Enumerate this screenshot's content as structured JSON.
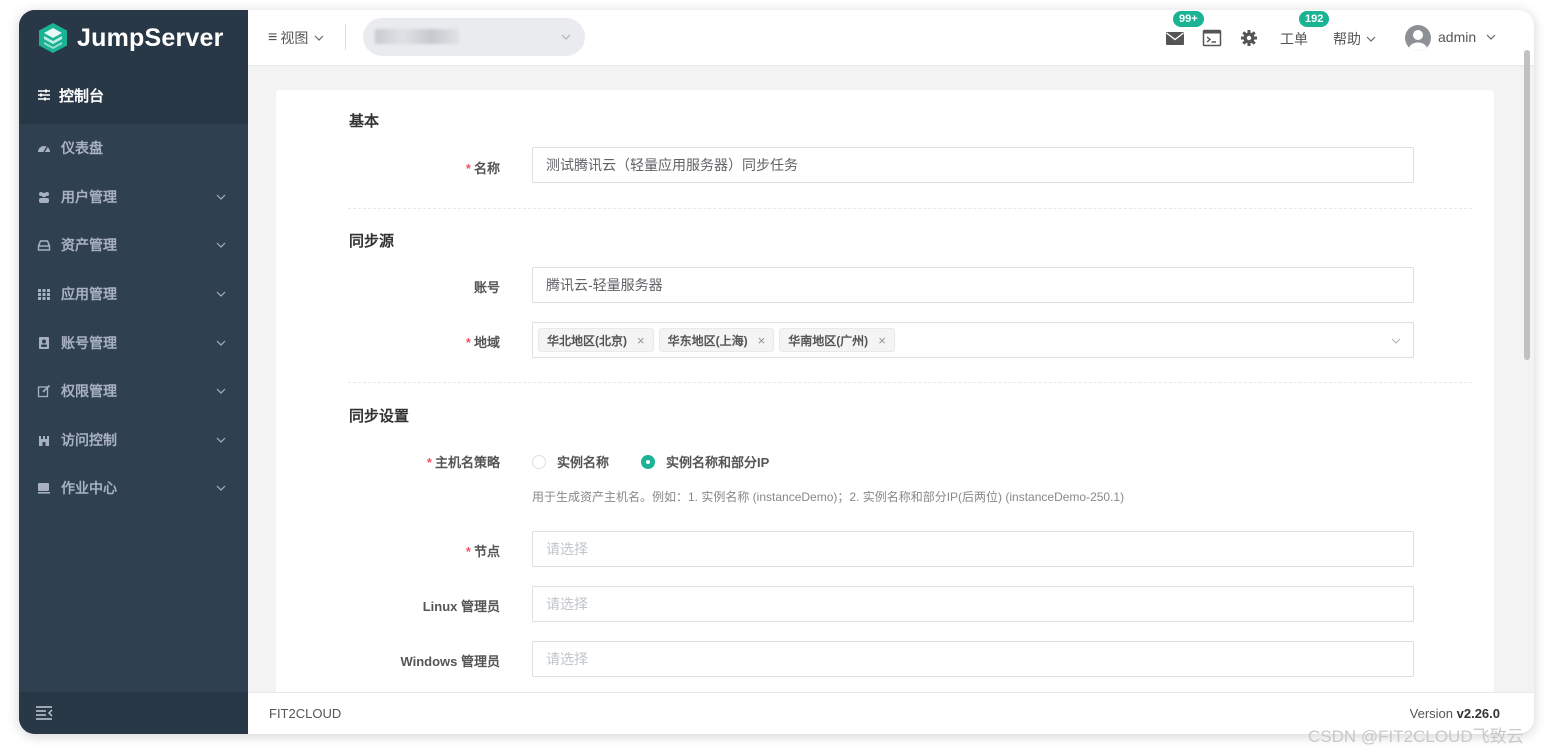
{
  "app": {
    "logo_text": "JumpServer",
    "brand_color": "#1ab394"
  },
  "sidebar": {
    "console_label": "控制台",
    "items": [
      {
        "label": "仪表盘",
        "icon": "dashboard-icon",
        "has_children": false
      },
      {
        "label": "用户管理",
        "icon": "users-icon",
        "has_children": true
      },
      {
        "label": "资产管理",
        "icon": "inbox-icon",
        "has_children": true
      },
      {
        "label": "应用管理",
        "icon": "grid-icon",
        "has_children": true
      },
      {
        "label": "账号管理",
        "icon": "address-book-icon",
        "has_children": true
      },
      {
        "label": "权限管理",
        "icon": "edit-icon",
        "has_children": true
      },
      {
        "label": "访问控制",
        "icon": "fort-icon",
        "has_children": true
      },
      {
        "label": "作业中心",
        "icon": "terminal-icon",
        "has_children": true
      }
    ]
  },
  "header": {
    "view_label": "视图",
    "messages_badge": "99+",
    "tickets_label": "工单",
    "tickets_badge": "192",
    "help_label": "帮助",
    "user_label": "admin"
  },
  "form": {
    "basic_title": "基本",
    "name_label": "名称",
    "name_value": "测试腾讯云（轻量应用服务器）同步任务",
    "source_title": "同步源",
    "account_label": "账号",
    "account_value": "腾讯云-轻量服务器",
    "region_label": "地域",
    "regions": [
      "华北地区(北京)",
      "华东地区(上海)",
      "华南地区(广州)"
    ],
    "sync_title": "同步设置",
    "hostname_label": "主机名策略",
    "hostname_options": [
      "实例名称",
      "实例名称和部分IP"
    ],
    "hostname_selected": "实例名称和部分IP",
    "hostname_help": "用于生成资产主机名。例如：1. 实例名称 (instanceDemo)；2. 实例名称和部分IP(后两位) (instanceDemo-250.1)",
    "node_label": "节点",
    "node_placeholder": "请选择",
    "linux_admin_label": "Linux 管理员",
    "linux_admin_placeholder": "请选择",
    "windows_admin_label": "Windows 管理员",
    "windows_admin_placeholder": "请选择"
  },
  "footer": {
    "company": "FIT2CLOUD",
    "version_prefix": "Version ",
    "version": "v2.26.0"
  },
  "watermark": "CSDN @FIT2CLOUD飞致云"
}
